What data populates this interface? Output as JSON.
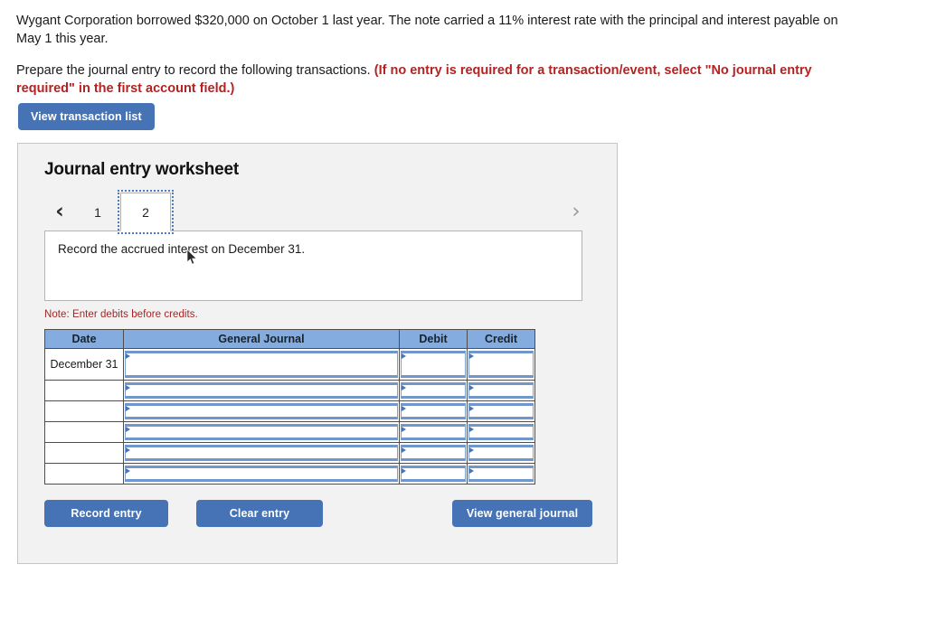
{
  "problem": {
    "paragraph1": "Wygant Corporation borrowed $320,000 on October 1 last year. The note carried a 11% interest rate with the principal and interest payable on May 1 this year.",
    "paragraph2_plain": "Prepare the journal entry to record the following transactions. ",
    "paragraph2_emphasis": "(If no entry is required for a transaction/event, select \"No journal entry required\" in the first account field.)"
  },
  "toolbar": {
    "view_transaction_list_label": "View transaction list"
  },
  "worksheet": {
    "title": "Journal entry worksheet",
    "prev_arrow": "‹",
    "next_arrow": "›",
    "tabs": [
      {
        "label": "1",
        "active": false
      },
      {
        "label": "2",
        "active": true
      }
    ],
    "description": "Record the accrued interest on December 31.",
    "note": "Note: Enter debits before credits."
  },
  "table": {
    "columns": [
      "Date",
      "General Journal",
      "Debit",
      "Credit"
    ],
    "rows": [
      {
        "date": "December 31",
        "general_journal": "",
        "debit": "",
        "credit": ""
      },
      {
        "date": "",
        "general_journal": "",
        "debit": "",
        "credit": ""
      },
      {
        "date": "",
        "general_journal": "",
        "debit": "",
        "credit": ""
      },
      {
        "date": "",
        "general_journal": "",
        "debit": "",
        "credit": ""
      },
      {
        "date": "",
        "general_journal": "",
        "debit": "",
        "credit": ""
      },
      {
        "date": "",
        "general_journal": "",
        "debit": "",
        "credit": ""
      }
    ]
  },
  "footer": {
    "record_entry_label": "Record entry",
    "clear_entry_label": "Clear entry",
    "view_general_journal_label": "View general journal"
  },
  "colors": {
    "button_blue": "#4573b5",
    "table_header_blue": "#84acdf",
    "field_border_blue": "#6f97cd",
    "note_red": "#a32626",
    "emphasis_red": "#b42222",
    "panel_background": "#f2f2f2",
    "panel_border": "#c6c6c6"
  }
}
